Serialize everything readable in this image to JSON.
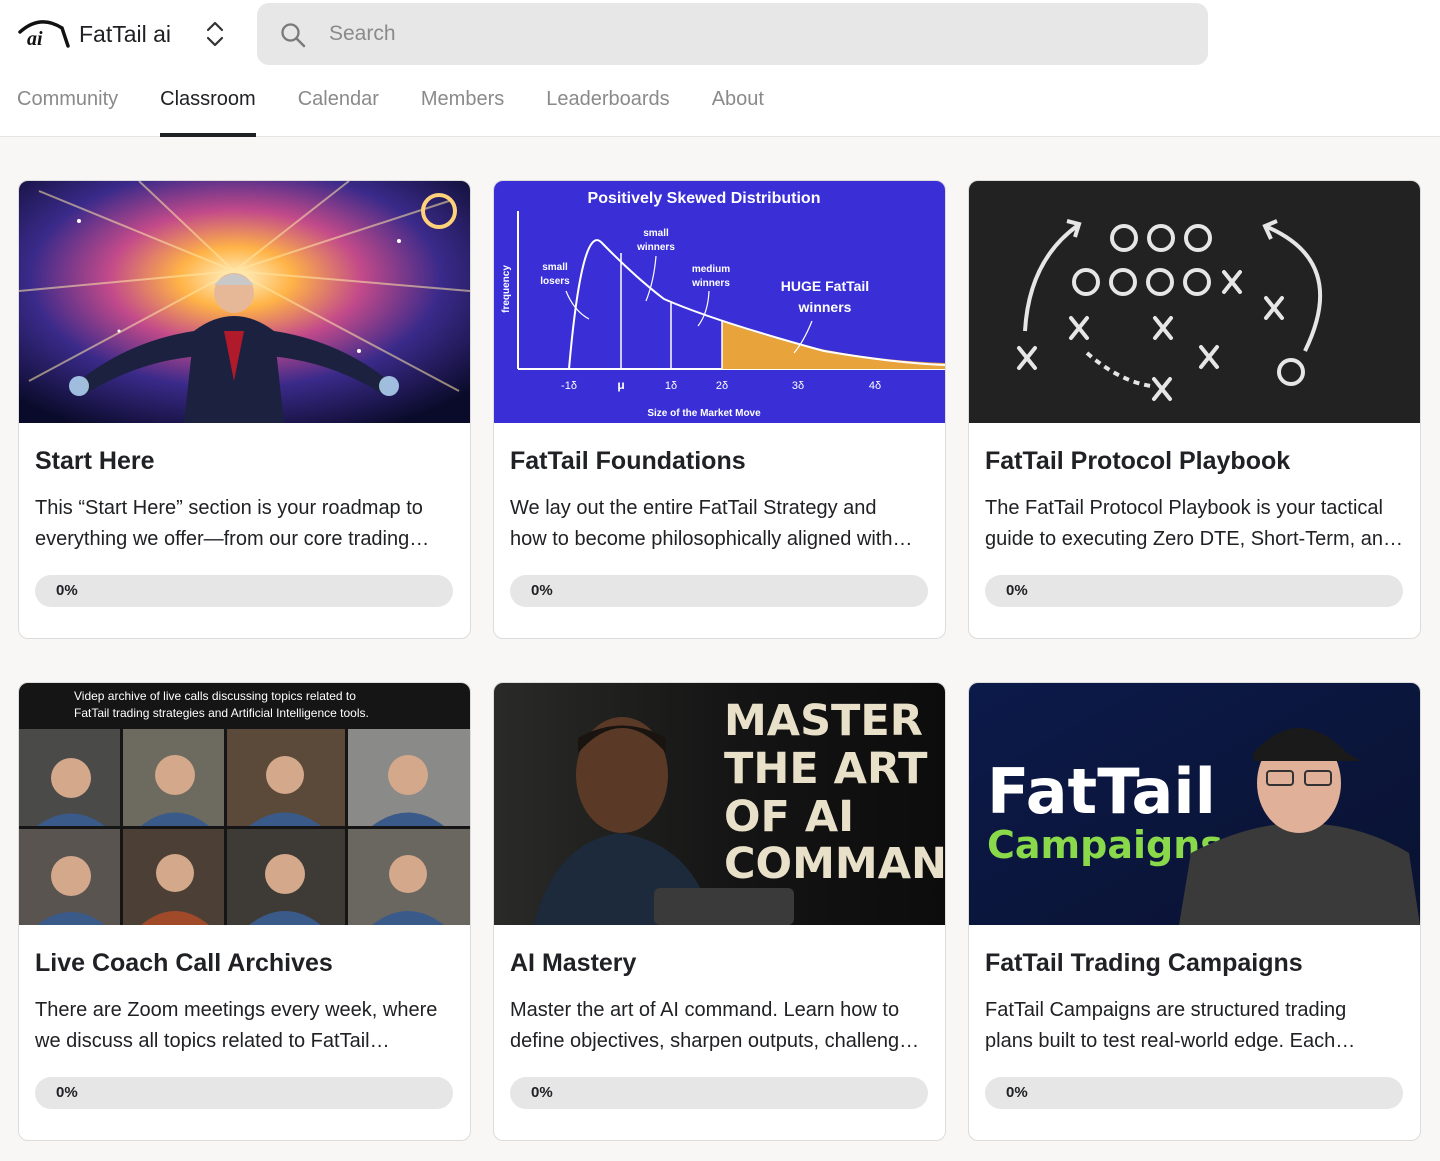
{
  "brand": {
    "name": "FatTail ai",
    "logo_text": "ai"
  },
  "search": {
    "placeholder": "Search"
  },
  "tabs": [
    {
      "label": "Community"
    },
    {
      "label": "Classroom"
    },
    {
      "label": "Calendar"
    },
    {
      "label": "Members"
    },
    {
      "label": "Leaderboards"
    },
    {
      "label": "About"
    }
  ],
  "active_tab": "Classroom",
  "courses": [
    {
      "title": "Start Here",
      "desc_lines": [
        "This “Start Here” section is your roadmap to",
        "everything we offer—from our core trading…"
      ],
      "progress_label": "0%",
      "progress": 0
    },
    {
      "title": "FatTail Foundations",
      "desc_lines": [
        "We lay out the entire FatTail Strategy and",
        "how to become philosophically aligned with…"
      ],
      "progress_label": "0%",
      "progress": 0,
      "thumb_text": {
        "title": "Positively Skewed Distribution",
        "ylabel": "frequency",
        "xlabel": "Size of the Market Move",
        "small_losers": [
          "small",
          "losers"
        ],
        "small_winners": [
          "small",
          "winners"
        ],
        "medium_winners": [
          "medium",
          "winners"
        ],
        "huge_winners": [
          "HUGE FatTail",
          "winners"
        ],
        "ticks": [
          "-1δ",
          "μ",
          "1δ",
          "2δ",
          "3δ",
          "4δ"
        ]
      }
    },
    {
      "title": "FatTail Protocol Playbook",
      "desc_lines": [
        "The FatTail Protocol Playbook is your tactical",
        "guide to executing Zero DTE, Short-Term, an…"
      ],
      "progress_label": "0%",
      "progress": 0
    },
    {
      "title": "Live Coach Call Archives",
      "desc_lines": [
        "There are Zoom meetings every week, where",
        "we discuss all topics related to FatTail…"
      ],
      "progress_label": "0%",
      "progress": 0,
      "thumb_text": {
        "caption": [
          "Videp archive of live calls discussing topics related to",
          "FatTail trading strategies and Artificial Intelligence tools."
        ]
      }
    },
    {
      "title": "AI Mastery",
      "desc_lines": [
        "Master the art of AI command. Learn how to",
        "define objectives, sharpen outputs, challeng…"
      ],
      "progress_label": "0%",
      "progress": 0,
      "thumb_text": {
        "lines": [
          "MASTER",
          "THE ART",
          "OF AI",
          "COMMAND"
        ]
      }
    },
    {
      "title": "FatTail Trading Campaigns",
      "desc_lines": [
        "FatTail Campaigns are structured trading",
        "plans built to test real-world edge. Each…"
      ],
      "progress_label": "0%",
      "progress": 0,
      "thumb_text": {
        "line1": "FatTail",
        "line2": "Campaigns"
      }
    }
  ],
  "colors": {
    "accent": "#202124",
    "progress_track": "#e6e6e6",
    "chart_bg": "#3a2fd6",
    "chart_fill": "#e8a33a",
    "campaign_green": "#8ad94a"
  }
}
